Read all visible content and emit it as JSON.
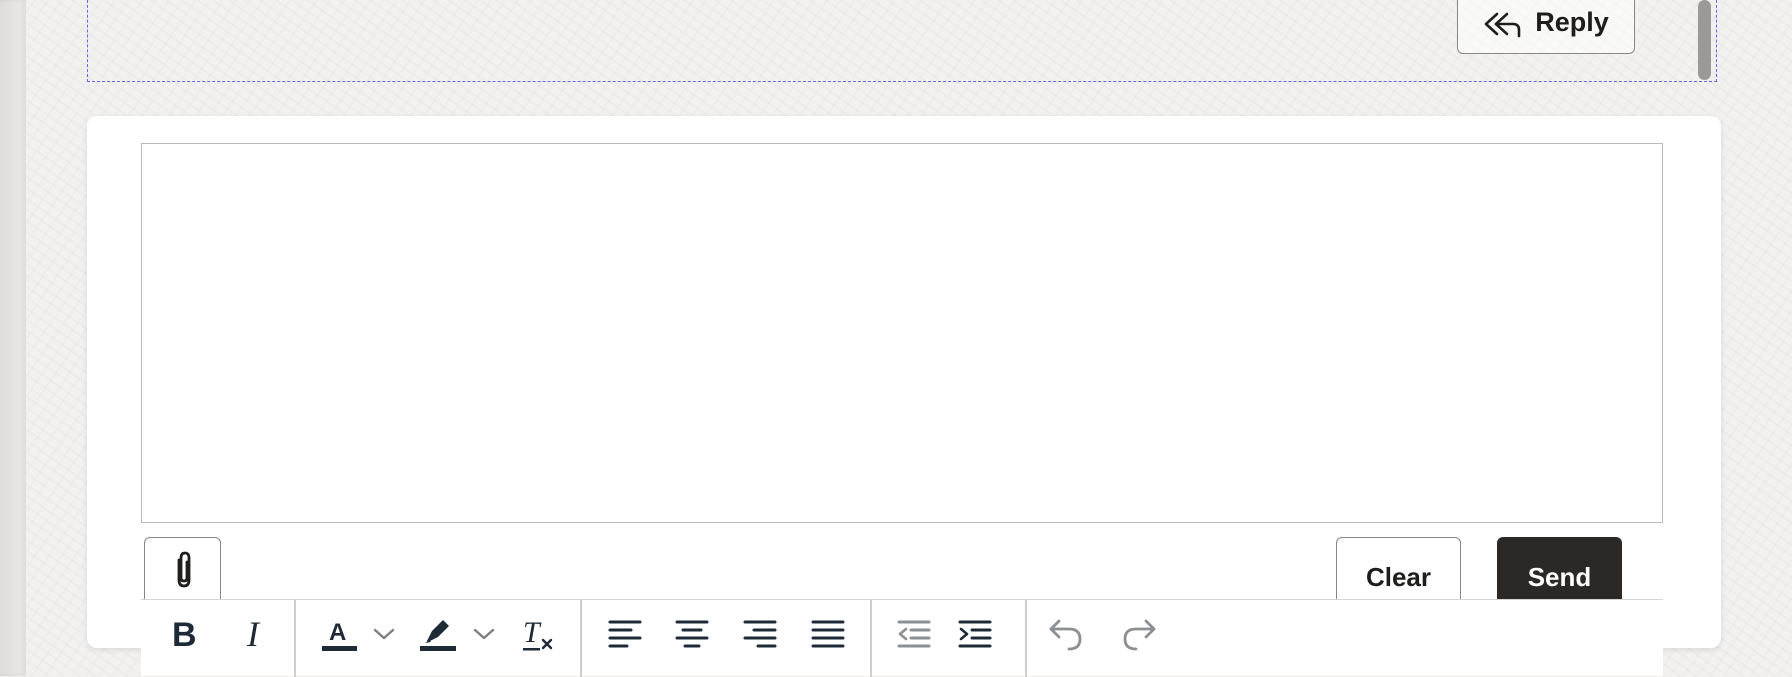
{
  "thread": {
    "reply_label": "Reply",
    "reply_icon": "reply-all-icon"
  },
  "composer": {
    "editor_value": "",
    "attach_icon": "paperclip-icon",
    "clear_label": "Clear",
    "send_label": "Send"
  },
  "toolbar": {
    "groups": [
      [
        "bold-icon",
        "italic-icon"
      ],
      [
        "text-color-icon",
        "chevron-down-icon",
        "highlight-color-icon",
        "chevron-down-icon",
        "clear-formatting-icon"
      ],
      [
        "align-left-icon",
        "align-center-icon",
        "align-right-icon",
        "align-justify-icon"
      ],
      [
        "outdent-icon",
        "indent-icon"
      ],
      [
        "undo-icon",
        "redo-icon"
      ]
    ],
    "disabled": [
      "outdent-icon",
      "undo-icon",
      "redo-icon"
    ]
  },
  "colors": {
    "send_bg": "#2c2825",
    "focus_dash": "#6b63e8",
    "icon_dark": "#1f2a37",
    "icon_disabled": "#8c8f94"
  }
}
